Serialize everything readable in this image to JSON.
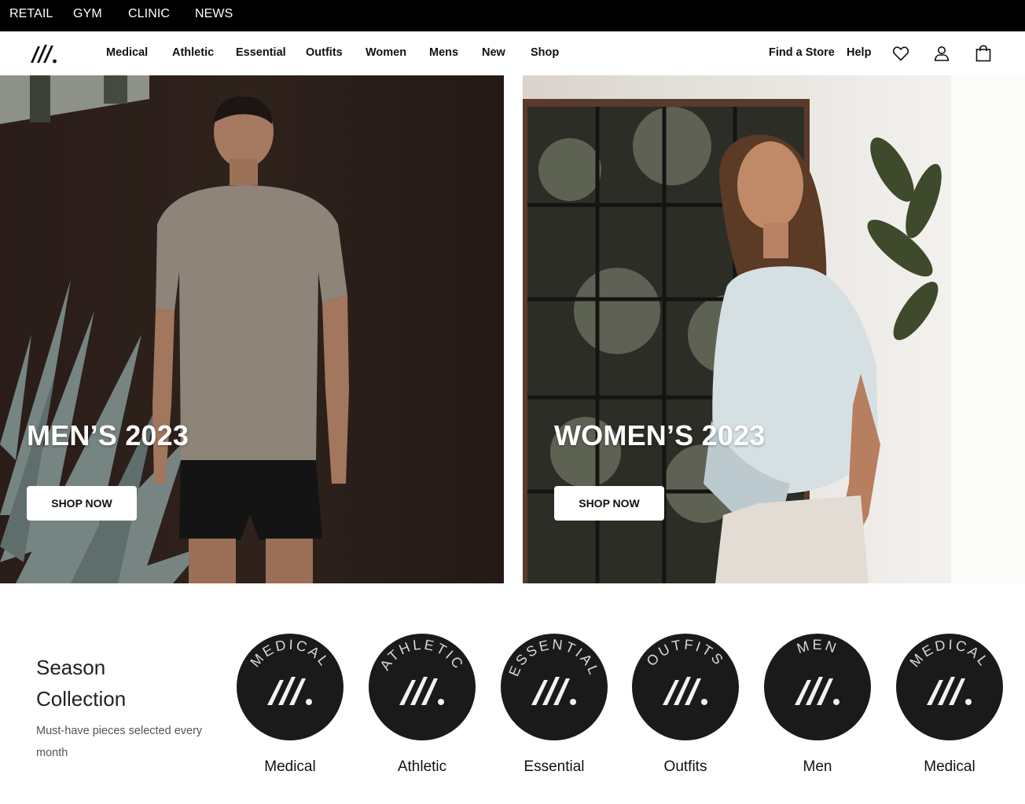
{
  "topbar": {
    "links": [
      "RETAIL",
      "GYM",
      "CLINIC",
      "NEWS"
    ]
  },
  "nav": {
    "links": [
      "Medical",
      "Athletic",
      "Essential",
      "Outfits",
      "Women",
      "Mens",
      "New",
      "Shop"
    ],
    "right_links": [
      "Find a Store",
      "Help"
    ],
    "icons": [
      "heart-icon",
      "user-icon",
      "bag-icon"
    ]
  },
  "hero": {
    "men": {
      "title": "MEN’S 2023",
      "button": "SHOP NOW"
    },
    "women": {
      "title": "WOMEN’S 2023",
      "button": "SHOP NOW"
    }
  },
  "season": {
    "title_line1": "Season",
    "title_line2": "Collection",
    "subtitle": "Must-have pieces selected every month",
    "categories": [
      {
        "badge": "MEDICAL",
        "label": "Medical"
      },
      {
        "badge": "ATHLETIC",
        "label": "Athletic"
      },
      {
        "badge": "ESSENTIAL",
        "label": "Essential"
      },
      {
        "badge": "OUTFITS",
        "label": "Outfits"
      },
      {
        "badge": "MEN",
        "label": "Men"
      },
      {
        "badge": "MEDICAL",
        "label": "Medical"
      }
    ]
  },
  "colors": {
    "topbar": "#000000",
    "badge": "#1a1a1a",
    "badge_text": "#d9d9d9"
  }
}
